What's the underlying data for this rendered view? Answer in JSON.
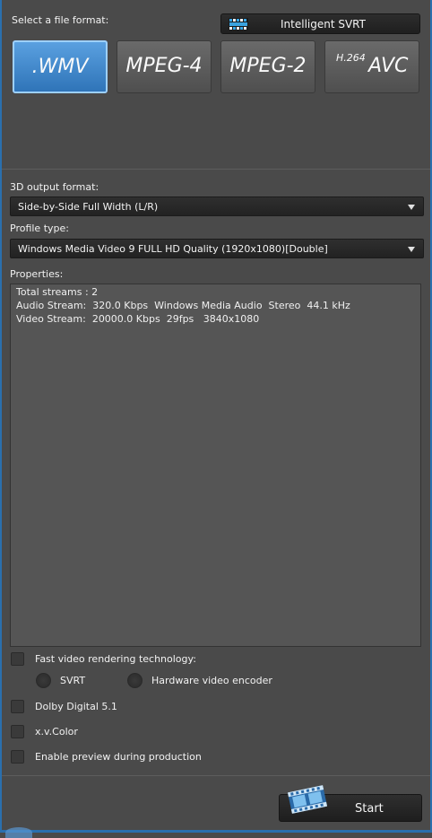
{
  "format_section": {
    "label": "Select a file format:",
    "svrt_button": "Intelligent SVRT",
    "formats": [
      {
        "label": ".WMV",
        "selected": true
      },
      {
        "label": "MPEG-4",
        "selected": false
      },
      {
        "label": "MPEG-2",
        "selected": false
      },
      {
        "prefix": "H.264",
        "label": "AVC",
        "selected": false
      }
    ]
  },
  "output_3d": {
    "label": "3D output format:",
    "value": "Side-by-Side Full Width (L/R)"
  },
  "profile": {
    "label": "Profile type:",
    "value": "Windows Media Video 9 FULL HD Quality (1920x1080)[Double]"
  },
  "properties": {
    "label": "Properties:",
    "lines": [
      "Total streams : 2",
      "Audio Stream:  320.0 Kbps  Windows Media Audio  Stereo  44.1 kHz",
      "Video Stream:  20000.0 Kbps  29fps   3840x1080"
    ]
  },
  "options": {
    "fast_rendering": "Fast video rendering technology:",
    "svrt": "SVRT",
    "hardware_encoder": "Hardware video encoder",
    "dolby": "Dolby Digital 5.1",
    "xvcolor": "x.v.Color",
    "preview": "Enable preview during production"
  },
  "start_button": "Start",
  "colors": {
    "background": "#4a4a4a",
    "selected_format": "#3f86cc",
    "frame": "#2a6fae"
  }
}
